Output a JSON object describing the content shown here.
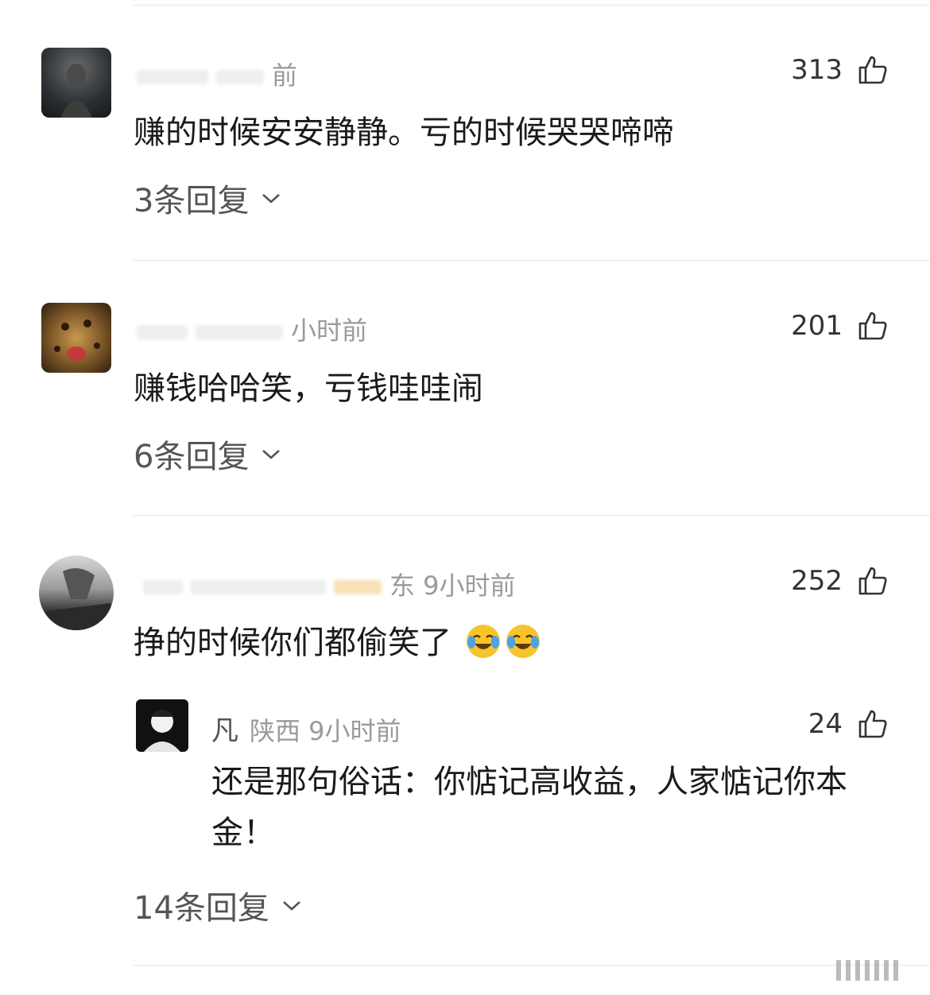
{
  "comments": [
    {
      "meta": "前",
      "likes": "313",
      "text": "赚的时候安安静静。亏的时候哭哭啼啼",
      "replies": "3条回复"
    },
    {
      "meta": "小时前",
      "likes": "201",
      "text": "赚钱哈哈笑，亏钱哇哇闹",
      "replies": "6条回复"
    },
    {
      "meta": "东 9小时前",
      "likes": "252",
      "text": "挣的时候你们都偷笑了",
      "replies": "14条回复",
      "sub_reply": {
        "name": "凡",
        "meta": "陕西 9小时前",
        "likes": "24",
        "text": "还是那句俗话：你惦记高收益，人家惦记你本金！"
      }
    }
  ],
  "icons": {
    "like": "thumbs-up-icon",
    "chevron": "chevron-down-icon",
    "emoji": "laughing-crying-emoji-icon"
  }
}
